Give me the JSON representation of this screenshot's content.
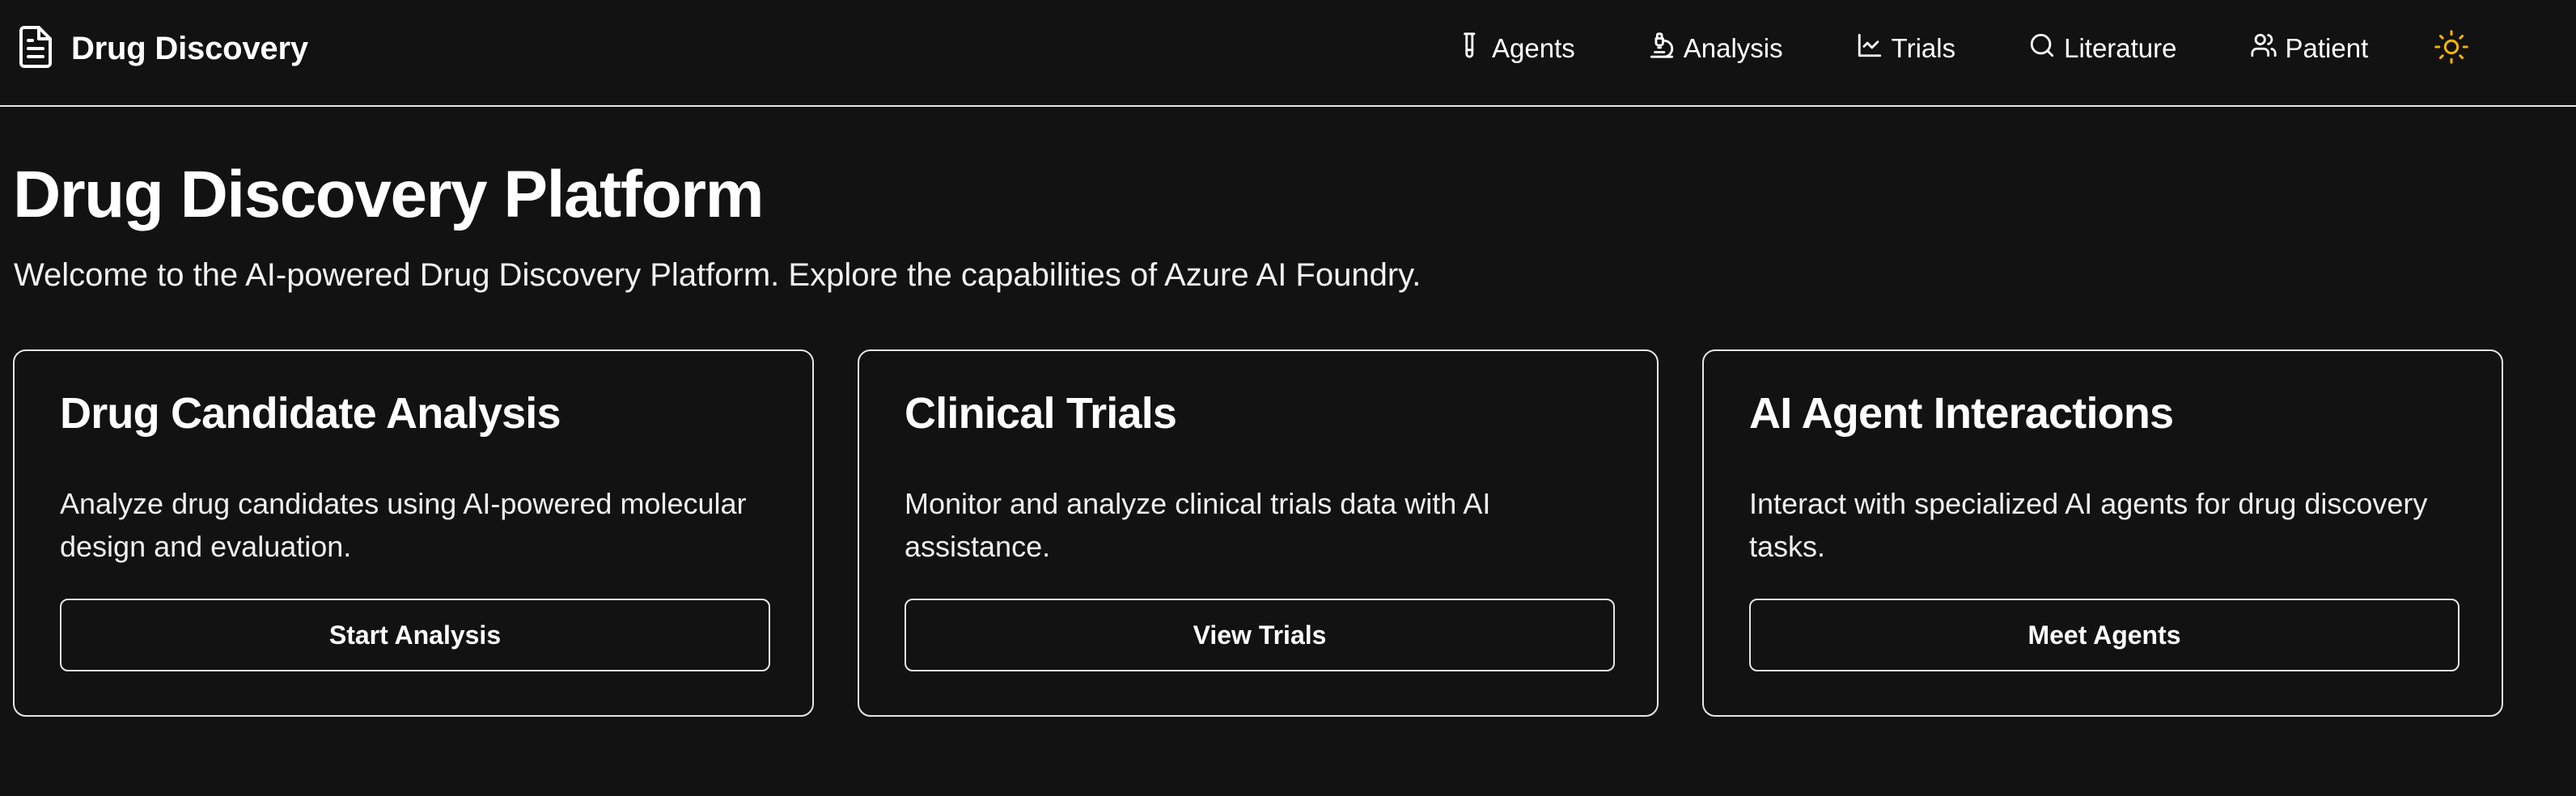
{
  "header": {
    "brand_title": "Drug Discovery",
    "brand_icon": "document-icon",
    "nav": [
      {
        "label": "Agents",
        "icon": "test-tube-icon"
      },
      {
        "label": "Analysis",
        "icon": "microscope-icon"
      },
      {
        "label": "Trials",
        "icon": "line-chart-icon"
      },
      {
        "label": "Literature",
        "icon": "search-icon"
      },
      {
        "label": "Patient",
        "icon": "users-icon"
      }
    ],
    "theme_icon": "sun-icon",
    "theme_color": "#f5b400"
  },
  "main": {
    "title": "Drug Discovery Platform",
    "subtitle": "Welcome to the AI-powered Drug Discovery Platform. Explore the capabilities of Azure AI Foundry.",
    "cards": [
      {
        "title": "Drug Candidate Analysis",
        "description": "Analyze drug candidates using AI-powered molecular design and evaluation.",
        "button": "Start Analysis"
      },
      {
        "title": "Clinical Trials",
        "description": "Monitor and analyze clinical trials data with AI assistance.",
        "button": "View Trials"
      },
      {
        "title": "AI Agent Interactions",
        "description": "Interact with specialized AI agents for drug discovery tasks.",
        "button": "Meet Agents"
      }
    ]
  },
  "colors": {
    "background": "#121212",
    "text": "#ffffff",
    "border": "#e6e6e6"
  }
}
